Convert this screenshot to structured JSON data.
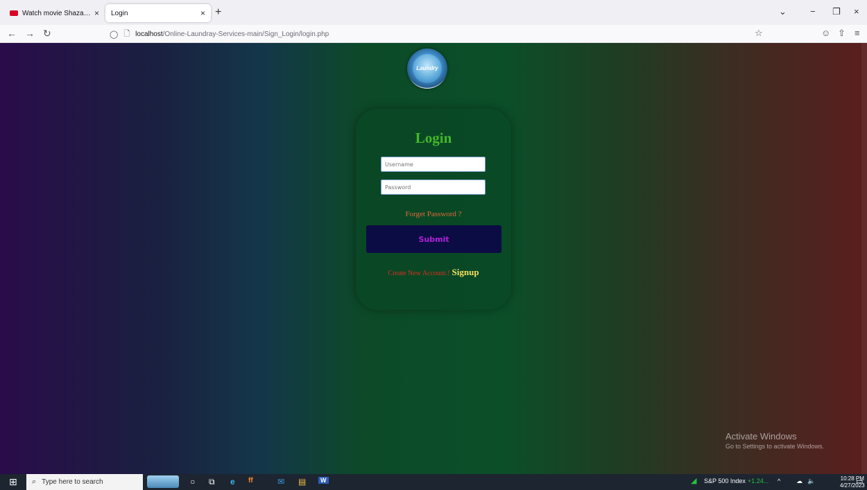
{
  "browser": {
    "tabs": [
      {
        "title": "Watch movie Shazam! Fury of the Gods",
        "close": "×",
        "active": false
      },
      {
        "title": "Login",
        "close": "×",
        "active": true
      }
    ],
    "new_tab": "+",
    "url_host": "localhost",
    "url_path": "/Online-Laundray-Services-main/Sign_Login/login.php",
    "icons": {
      "back": "←",
      "forward": "→",
      "reload": "↻",
      "shield": "◯",
      "page": "🗋",
      "bookmark": "☆",
      "pocket": "☺",
      "extensions": "⇧",
      "menu": "≡",
      "list_tabs": "⌄",
      "minimize": "−",
      "restore": "❐",
      "close": "×"
    }
  },
  "login": {
    "logo_text": "Laundry",
    "title": "Login",
    "username_placeholder": "Username",
    "password_placeholder": "Password",
    "forgot": "Forget Password ?",
    "submit": "Submit",
    "create_account": "Create New Account.!",
    "signup": "Signup"
  },
  "watermark": {
    "line1": "Activate Windows",
    "line2": "Go to Settings to activate Windows."
  },
  "taskbar": {
    "search_placeholder": "Type here to search",
    "stock_label": "S&P 500 Index",
    "stock_change": "+1.24...",
    "time": "10:28 PM",
    "date": "4/27/2023",
    "icons": {
      "windows": "⊞",
      "search": "⌕",
      "cortana": "○",
      "task_view": "⧉",
      "edge": "e",
      "firefox": "ff",
      "mail": "✉",
      "explorer": "▤",
      "word": "W",
      "chevron": "^",
      "network": "☁",
      "volume": "🔈",
      "notification": "▭"
    }
  },
  "colors": {
    "title_green": "#43b82a",
    "forgot_orange": "#e06a3a",
    "submit_bg": "#0c0c44",
    "submit_text": "#b020d8",
    "create_red": "#d83020",
    "signup_yellow": "#f0e060"
  }
}
